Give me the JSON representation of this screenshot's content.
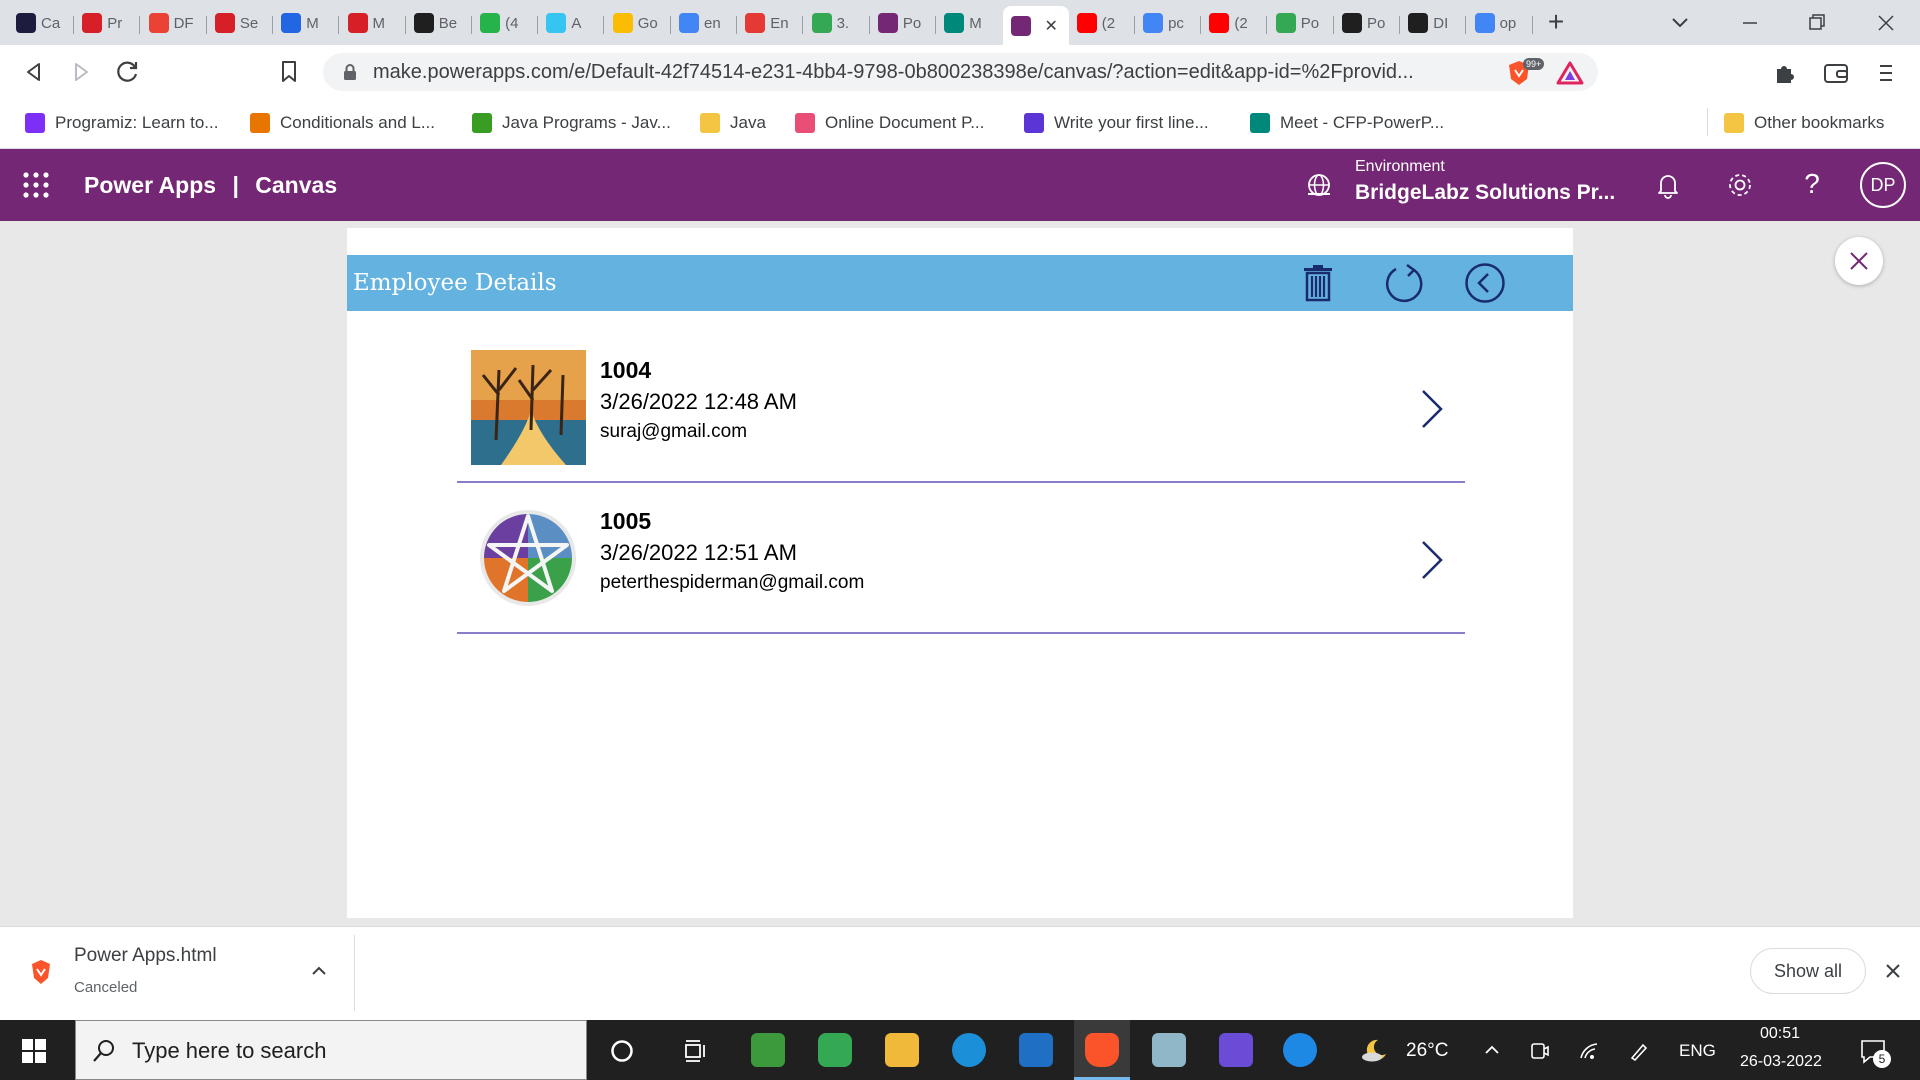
{
  "browser": {
    "tabs": [
      {
        "label": "Ca",
        "icon": "app-icon",
        "color": "#1d1c3f"
      },
      {
        "label": "Pr",
        "icon": "oracle-icon",
        "color": "#d61f26"
      },
      {
        "label": "DF",
        "icon": "gmail-icon",
        "color": "#ea4335"
      },
      {
        "label": "Se",
        "icon": "oracle-icon",
        "color": "#d61f26"
      },
      {
        "label": "M",
        "icon": "power-automate-icon",
        "color": "#2266e3"
      },
      {
        "label": "M",
        "icon": "oracle-icon",
        "color": "#d61f26"
      },
      {
        "label": "Be",
        "icon": "cb-icon",
        "color": "#1f1f1f"
      },
      {
        "label": "(4",
        "icon": "whatsapp-badge-icon",
        "color": "#25b34a"
      },
      {
        "label": "A",
        "icon": "slack-icon",
        "color": "#36c5f0"
      },
      {
        "label": "Go",
        "icon": "keep-icon",
        "color": "#fbbc04"
      },
      {
        "label": "en",
        "icon": "google-icon",
        "color": "#4285f4"
      },
      {
        "label": "En",
        "icon": "m-icon",
        "color": "#e53935"
      },
      {
        "label": "3.",
        "icon": "drive-icon",
        "color": "#34a853"
      },
      {
        "label": "Po",
        "icon": "powerapps-icon",
        "color": "#742774"
      },
      {
        "label": "M",
        "icon": "meet-icon",
        "color": "#00897b"
      },
      {
        "label": "",
        "icon": "powerapps-icon",
        "color": "#742774",
        "active": true
      },
      {
        "label": "(2",
        "icon": "youtube-icon",
        "color": "#ff0000"
      },
      {
        "label": "pc",
        "icon": "google-icon",
        "color": "#4285f4"
      },
      {
        "label": "(2",
        "icon": "youtube-icon",
        "color": "#ff0000"
      },
      {
        "label": "Po",
        "icon": "sheets-icon",
        "color": "#34a853"
      },
      {
        "label": "Po",
        "icon": "github-icon",
        "color": "#1f1f1f"
      },
      {
        "label": "DI",
        "icon": "github-icon",
        "color": "#1f1f1f"
      },
      {
        "label": "op",
        "icon": "google-icon",
        "color": "#4285f4"
      }
    ],
    "url": "make.powerapps.com/e/Default-42f74514-e231-4bb4-9798-0b800238398e/canvas/?action=edit&app-id=%2Fprovid...",
    "brave_badge": "99+",
    "bookmarks": [
      {
        "label": "Programiz: Learn to...",
        "icon": "programiz-icon",
        "color": "#7b2ff7"
      },
      {
        "label": "Conditionals and L...",
        "icon": "princeton-icon",
        "color": "#e77500"
      },
      {
        "label": "Java Programs - Jav...",
        "icon": "beginnersbook-icon",
        "color": "#3a9d23"
      },
      {
        "label": "Java",
        "icon": "folder-icon",
        "color": "#f4c542"
      },
      {
        "label": "Online Document P...",
        "icon": "pinwheel-icon",
        "color": "#e94e77"
      },
      {
        "label": "Write your first line...",
        "icon": "learn-icon",
        "color": "#5b35d5"
      },
      {
        "label": "Meet - CFP-PowerP...",
        "icon": "meet-icon",
        "color": "#00897b"
      }
    ],
    "other_bookmarks": "Other bookmarks"
  },
  "app": {
    "title": "Power Apps",
    "separator": "|",
    "section": "Canvas",
    "environment_label": "Environment",
    "environment_value": "BridgeLabz Solutions Pr...",
    "avatar": "DP",
    "accent": "#742774"
  },
  "screen": {
    "title": "Employee Details",
    "header_color": "#64b2e0",
    "records": [
      {
        "id": "1004",
        "date": "3/26/2022 12:48 AM",
        "email": "suraj@gmail.com",
        "image": "landscape-thumbnail"
      },
      {
        "id": "1005",
        "date": "3/26/2022 12:51 AM",
        "email": "peterthespiderman@gmail.com",
        "image": "pentagram-thumbnail"
      }
    ]
  },
  "download": {
    "filename": "Power Apps.html",
    "status": "Canceled",
    "show_all": "Show all"
  },
  "taskbar": {
    "search_placeholder": "Type here to search",
    "temperature": "26°C",
    "language": "ENG",
    "time": "00:51",
    "date": "26-03-2022",
    "notification_count": "5"
  }
}
